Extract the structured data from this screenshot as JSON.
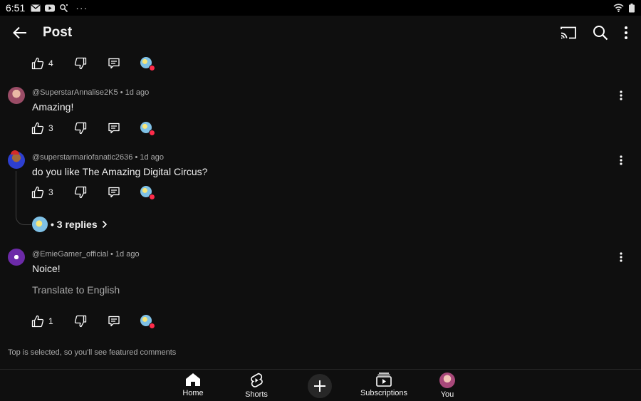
{
  "statusbar": {
    "time": "6:51",
    "more": "···"
  },
  "appbar": {
    "title": "Post"
  },
  "top_actions": {
    "likes": "4"
  },
  "comments": [
    {
      "author": "@SuperstarAnnalise2K5",
      "age": "• 1d ago",
      "text": "Amazing!",
      "likes": "3"
    },
    {
      "author": "@superstarmariofanatic2636",
      "age": "• 1d ago",
      "text": "do you like The Amazing Digital Circus?",
      "likes": "3",
      "replies": "• 3 replies"
    },
    {
      "author": "@EmieGamer_official",
      "age": "• 1d ago",
      "text": "Noice!",
      "translate": "Translate to English",
      "likes": "1"
    }
  ],
  "notice": "Top is selected, so you'll see featured comments",
  "nav": {
    "home": "Home",
    "shorts": "Shorts",
    "subscriptions": "Subscriptions",
    "you": "You"
  },
  "icons": [
    "back-arrow-icon",
    "cast-icon",
    "search-icon",
    "more-vert-icon",
    "thumb-up-icon",
    "thumb-down-icon",
    "comment-icon",
    "heart-avatar-icon",
    "home-icon",
    "shorts-icon",
    "create-plus-icon",
    "subscriptions-icon"
  ],
  "colors": {
    "background": "#0f0f0f",
    "text": "#f1f1f1",
    "secondary": "#aaaaaa",
    "heart_dot": "#ff2b4a"
  }
}
